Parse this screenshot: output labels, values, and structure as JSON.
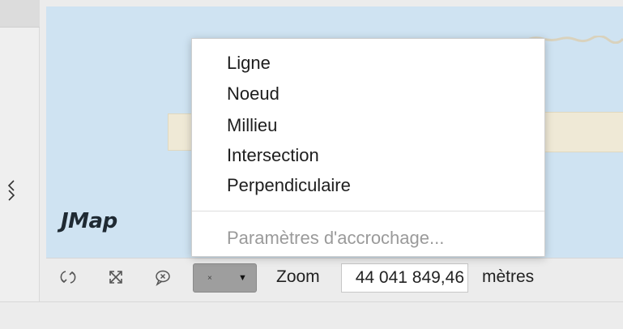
{
  "map": {
    "logo_text": "JMap"
  },
  "toolbar": {
    "snap_selected": "×",
    "snap_caret": "▼",
    "zoom_label": "Zoom",
    "zoom_value": "44 041 849,46",
    "unit_label": "mètres"
  },
  "snap_menu": {
    "items": [
      {
        "label": "Ligne"
      },
      {
        "label": "Noeud"
      },
      {
        "label": "Millieu"
      },
      {
        "label": "Intersection"
      },
      {
        "label": "Perpendiculaire"
      }
    ],
    "settings_label": "Paramètres d'accrochage..."
  },
  "colors": {
    "map_water": "#cfe3f2",
    "map_land": "#efe9d6",
    "combo_bg": "#9e9e9e"
  },
  "icons": {
    "toolbar": [
      "rotate-icon",
      "fit-extent-icon",
      "comment-icon"
    ],
    "panel": "collapse-chevron-icon"
  }
}
